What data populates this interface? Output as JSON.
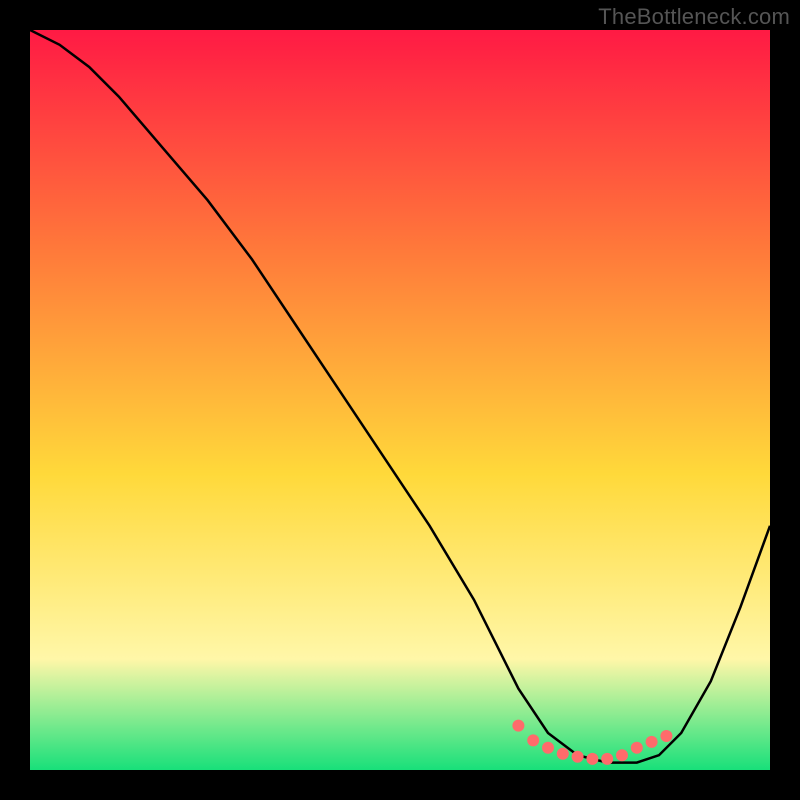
{
  "watermark": "TheBottleneck.com",
  "chart_data": {
    "type": "line",
    "title": "",
    "xlabel": "",
    "ylabel": "",
    "xlim": [
      0,
      100
    ],
    "ylim": [
      0,
      100
    ],
    "grid": false,
    "background_gradient": {
      "top": "#ff1a44",
      "mid1": "#ff7a3a",
      "mid2": "#ffd93a",
      "mid3": "#fff7a8",
      "bottom": "#18e07a"
    },
    "series": [
      {
        "name": "bottleneck-curve",
        "color": "#000000",
        "x": [
          0,
          4,
          8,
          12,
          18,
          24,
          30,
          36,
          42,
          48,
          54,
          60,
          63,
          66,
          70,
          74,
          78,
          82,
          85,
          88,
          92,
          96,
          100
        ],
        "y": [
          100,
          98,
          95,
          91,
          84,
          77,
          69,
          60,
          51,
          42,
          33,
          23,
          17,
          11,
          5,
          2,
          1,
          1,
          2,
          5,
          12,
          22,
          33
        ]
      }
    ],
    "markers": {
      "name": "highlight-region",
      "color": "#ff6b6b",
      "x": [
        66,
        68,
        70,
        72,
        74,
        76,
        78,
        80,
        82,
        84,
        86
      ],
      "y": [
        6,
        4,
        3,
        2.2,
        1.8,
        1.5,
        1.5,
        2,
        3,
        3.8,
        4.6
      ]
    }
  }
}
